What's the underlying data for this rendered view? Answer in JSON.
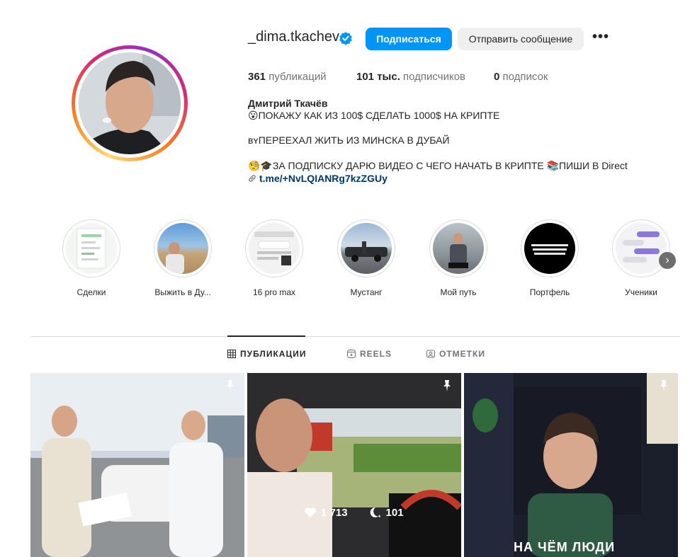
{
  "profile": {
    "username": "_dima.tkachev",
    "follow_label": "Подписаться",
    "message_label": "Отправить сообщение",
    "more_label": "•••",
    "stats": {
      "posts_count": "361",
      "posts_label": "публикаций",
      "followers_count": "101 тыс.",
      "followers_label": "подписчиков",
      "following_count": "0",
      "following_label": "подписок"
    },
    "bio": {
      "name": "Дмитрий Ткачёв",
      "line1": "😮ПОКАЖУ КАК ИЗ 100$ СДЕЛАТЬ 1000$ НА КРИПТЕ",
      "line2": "ʙʏПЕРЕЕХАЛ ЖИТЬ ИЗ МИНСКА В ДУБАЙ",
      "line3": "🧐🎓ЗА ПОДПИСКУ ДАРЮ ВИДЕО С ЧЕГО НАЧАТЬ В КРИПТЕ 📚ПИШИ В Direct",
      "link": "t.me/+NvLQIANRg7kzZGUy"
    }
  },
  "highlights": [
    {
      "label": "Сделки"
    },
    {
      "label": "Выжить в Ду..."
    },
    {
      "label": "16 pro max"
    },
    {
      "label": "Мустанг"
    },
    {
      "label": "Мой путь"
    },
    {
      "label": "Портфель"
    },
    {
      "label": "Ученики"
    }
  ],
  "tabs": [
    {
      "label": "ПУБЛИКАЦИИ",
      "icon": "grid-icon"
    },
    {
      "label": "REELS",
      "icon": "reels-icon"
    },
    {
      "label": "ОТМЕТКИ",
      "icon": "tagged-icon"
    }
  ],
  "posts": [
    {
      "pinned": true
    },
    {
      "pinned": true,
      "likes": "1 713",
      "comments": "101"
    },
    {
      "pinned": true,
      "caption": "НА ЧЁМ ЛЮДИ"
    }
  ],
  "colors": {
    "accent": "#0095f6",
    "link": "#00376b",
    "verified": "#0095f6"
  }
}
